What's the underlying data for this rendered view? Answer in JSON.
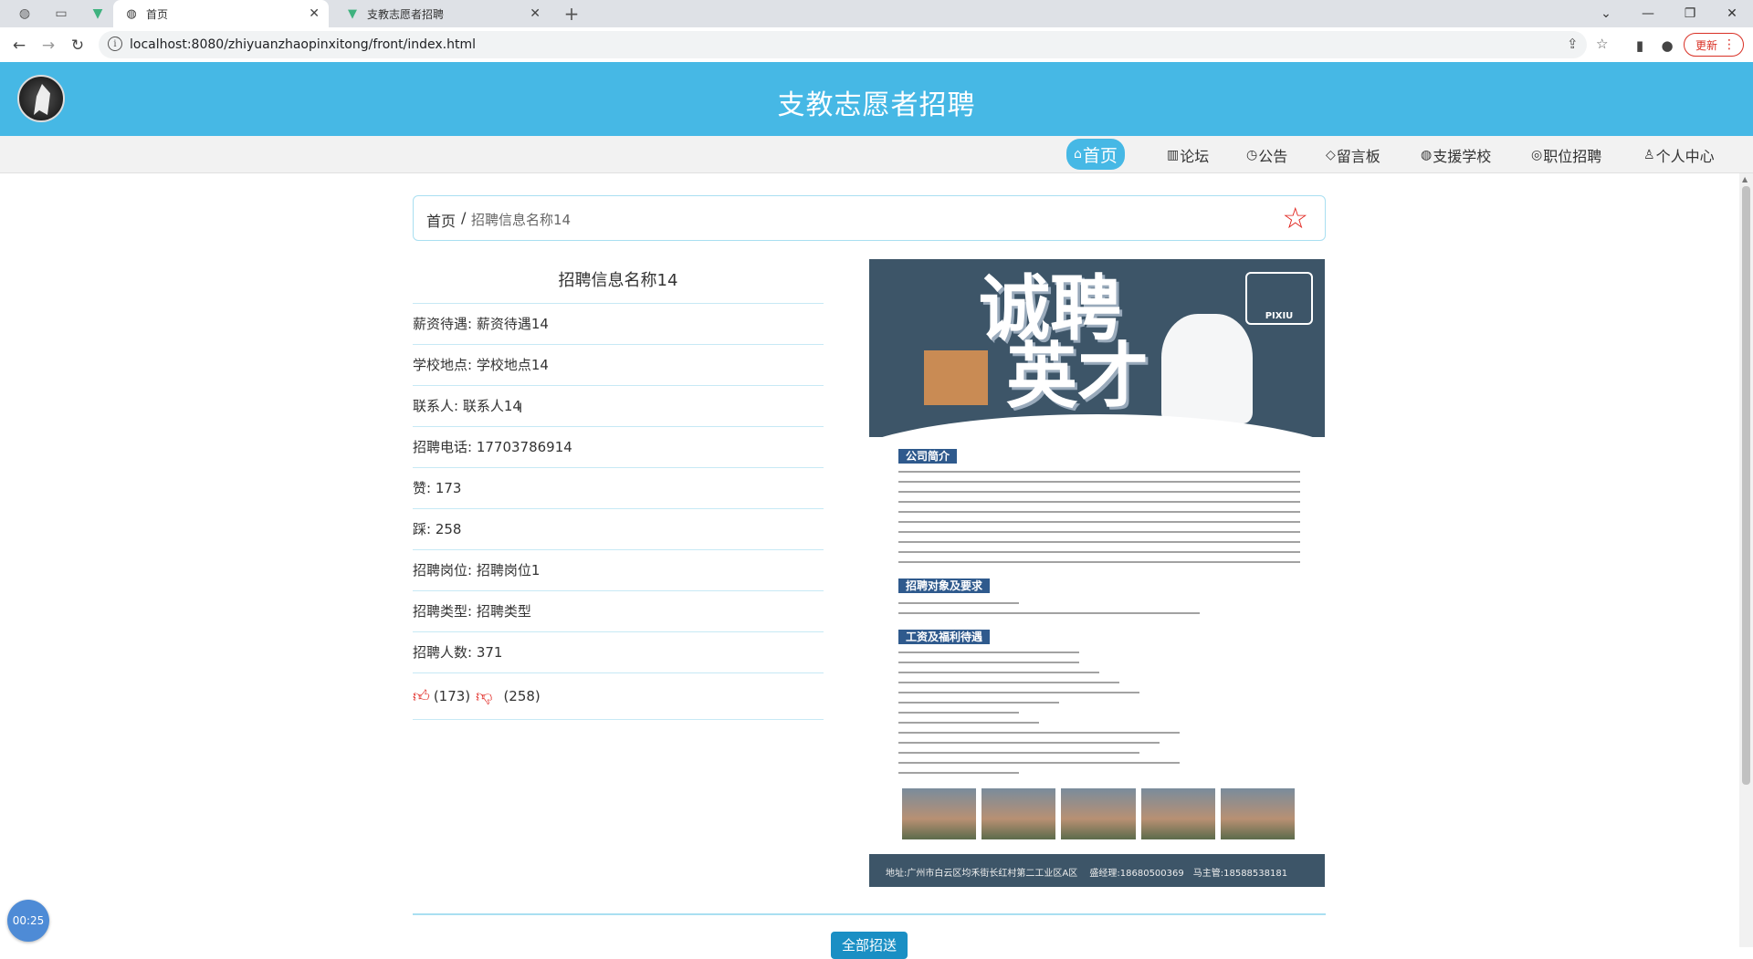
{
  "browser": {
    "tabs": [
      {
        "label": "首页",
        "icon": "globe-icon"
      },
      {
        "label": "支教志愿者招聘",
        "icon": "vue-icon"
      }
    ],
    "new_tab": "+",
    "url": "localhost:8080/zhiyuanzhaopinxitong/front/index.html",
    "update_label": "更新"
  },
  "site": {
    "title": "支教志愿者招聘",
    "nav": [
      {
        "label": "首页",
        "icon": "home-icon"
      },
      {
        "label": "论坛",
        "icon": "forum-icon"
      },
      {
        "label": "公告",
        "icon": "announcement-icon"
      },
      {
        "label": "留言板",
        "icon": "tag-icon"
      },
      {
        "label": "支援学校",
        "icon": "globe-icon"
      },
      {
        "label": "职位招聘",
        "icon": "badge-icon"
      },
      {
        "label": "个人中心",
        "icon": "user-icon"
      }
    ]
  },
  "breadcrumb": {
    "home": "首页",
    "sep": "/",
    "current": "招聘信息名称14"
  },
  "detail": {
    "title": "招聘信息名称14",
    "rows": [
      "薪资待遇: 薪资待遇14",
      "学校地点: 学校地点14",
      "联系人: 联系人14",
      "招聘电话: 17703786914",
      "赞: 173",
      "踩: 258",
      "招聘岗位: 招聘岗位1",
      "招聘类型: 招聘类型",
      "招聘人数: 371"
    ],
    "likes": "(173)",
    "dislikes": "(258)"
  },
  "poster": {
    "headline1": "诚聘",
    "headline2": "英才",
    "logo_text": "PIXIU",
    "sections": [
      "公司简介",
      "招聘对象及要求",
      "工资及福利待遇"
    ],
    "footer": "地址:广州市白云区均禾街长红村第二工业区A区　 盛经理:18680500369　马主管:18588538181"
  },
  "all_button": "全部招送",
  "timer": "00:25",
  "colors": {
    "brand": "#46b8e5",
    "star": "#e0201a"
  }
}
